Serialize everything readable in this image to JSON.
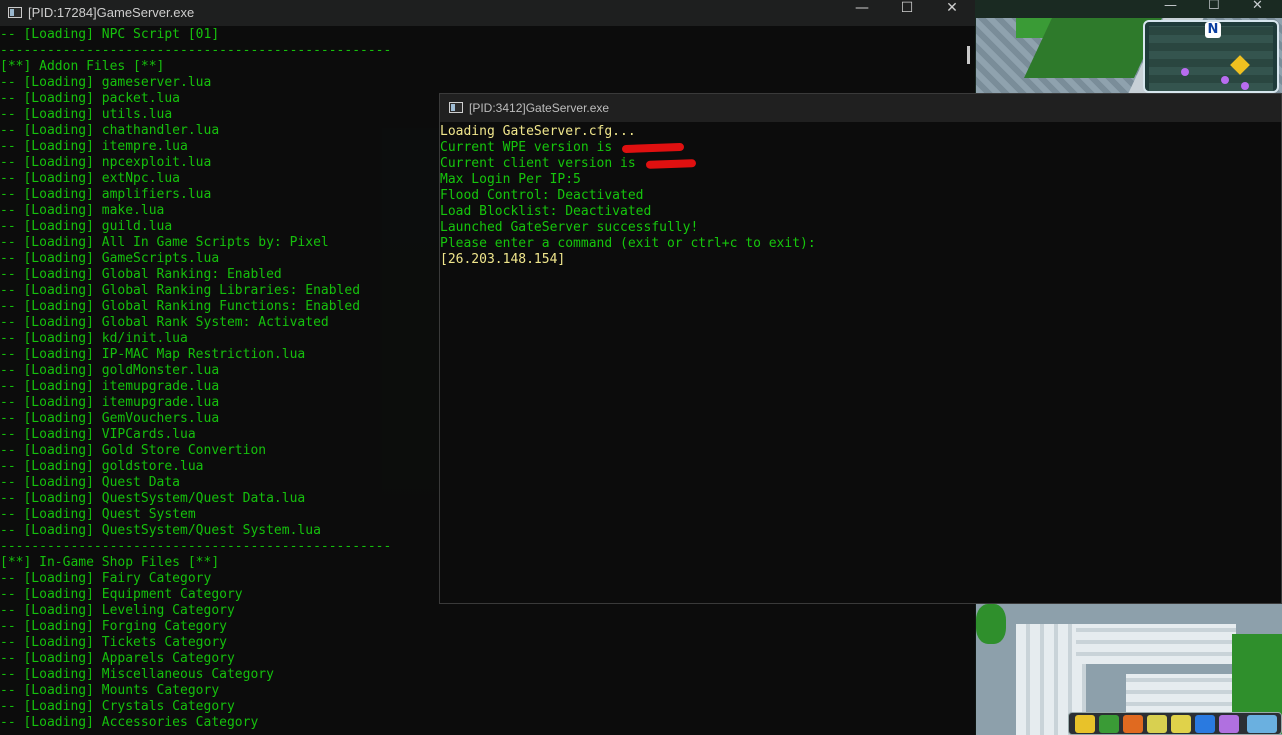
{
  "game_window": {
    "controls": {
      "minimize": "—",
      "maximize": "☐",
      "close": "✕"
    },
    "minimap_north": "N"
  },
  "gameserver_window": {
    "title": "[PID:17284]GameServer.exe",
    "controls": {
      "minimize": "—",
      "maximize": "☐",
      "close": "✕"
    },
    "lines": [
      "-- [Loading] NPC Script [01]",
      "--------------------------------------------------",
      "[**] Addon Files [**]",
      "-- [Loading] gameserver.lua",
      "-- [Loading] packet.lua",
      "-- [Loading] utils.lua",
      "-- [Loading] chathandler.lua",
      "-- [Loading] itempre.lua",
      "-- [Loading] npcexploit.lua",
      "-- [Loading] extNpc.lua",
      "-- [Loading] amplifiers.lua",
      "-- [Loading] make.lua",
      "-- [Loading] guild.lua",
      "-- [Loading] All In Game Scripts by: Pixel",
      "-- [Loading] GameScripts.lua",
      "-- [Loading] Global Ranking: Enabled",
      "-- [Loading] Global Ranking Libraries: Enabled",
      "-- [Loading] Global Ranking Functions: Enabled",
      "-- [Loading] Global Rank System: Activated",
      "-- [Loading] kd/init.lua",
      "-- [Loading] IP-MAC Map Restriction.lua",
      "-- [Loading] goldMonster.lua",
      "-- [Loading] itemupgrade.lua",
      "-- [Loading] itemupgrade.lua",
      "-- [Loading] GemVouchers.lua",
      "-- [Loading] VIPCards.lua",
      "-- [Loading] Gold Store Convertion",
      "-- [Loading] goldstore.lua",
      "-- [Loading] Quest Data",
      "-- [Loading] QuestSystem/Quest Data.lua",
      "-- [Loading] Quest System",
      "-- [Loading] QuestSystem/Quest System.lua",
      "--------------------------------------------------",
      "[**] In-Game Shop Files [**]",
      "-- [Loading] Fairy Category",
      "-- [Loading] Equipment Category",
      "-- [Loading] Leveling Category",
      "-- [Loading] Forging Category",
      "-- [Loading] Tickets Category",
      "-- [Loading] Apparels Category",
      "-- [Loading] Miscellaneous Category",
      "-- [Loading] Mounts Category",
      "-- [Loading] Crystals Category",
      "-- [Loading] Accessories Category"
    ]
  },
  "gateserver_window": {
    "title": "[PID:3412]GateServer.exe",
    "lines": [
      {
        "text": "Loading GateServer.cfg...",
        "color": "yellow"
      },
      {
        "text": "Current WPE version is ",
        "color": "green",
        "redacted": true
      },
      {
        "text": "Current client version is ",
        "color": "green",
        "redacted": true
      },
      {
        "text": "Max Login Per IP:5",
        "color": "green"
      },
      {
        "text": "Flood Control: Deactivated",
        "color": "green"
      },
      {
        "text": "Load Blocklist: Deactivated",
        "color": "green"
      },
      {
        "text": "Launched GateServer successfully!",
        "color": "green"
      },
      {
        "text": "Please enter a command (exit or ctrl+c to exit):",
        "color": "green"
      },
      {
        "text": "[26.203.148.154]",
        "color": "yellow"
      }
    ]
  },
  "colors": {
    "green": "#16c60c",
    "yellow": "#f0e68c",
    "redaction": "#e01010",
    "console_bg": "#0c0c0c"
  }
}
